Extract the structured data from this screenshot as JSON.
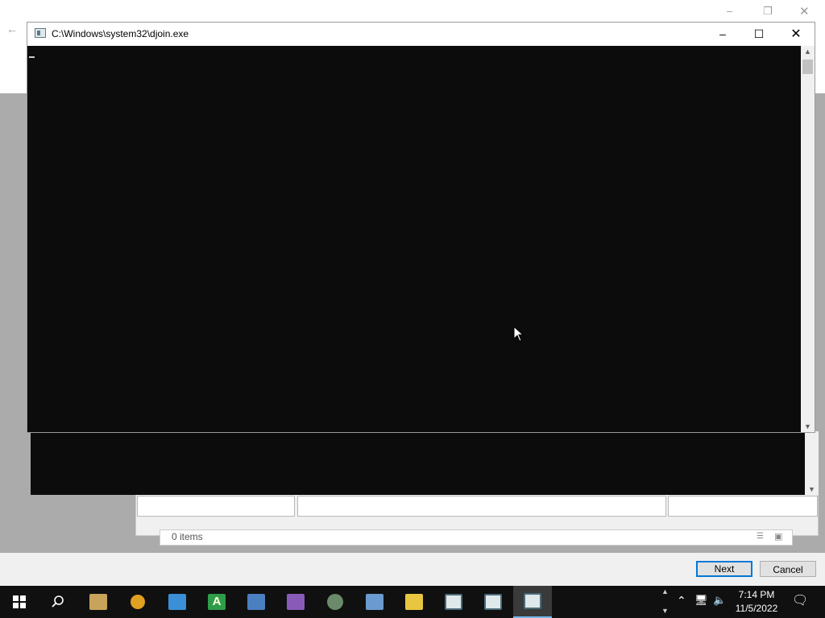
{
  "wizard": {
    "next_label": "Next",
    "cancel_label": "Cancel",
    "items_count": "0 items"
  },
  "console": {
    "title": "C:\\Windows\\system32\\djoin.exe"
  },
  "taskbar": {
    "time": "7:14 PM",
    "date": "11/5/2022",
    "apps": [
      "start-icon",
      "search-icon",
      "file-cabinet-icon",
      "magnifier-key-icon",
      "network-computer-icon",
      "font-a-icon",
      "document-tools-icon",
      "bookmark-icon",
      "disc-icon",
      "printer-computer-icon",
      "phone-icon",
      "window-app-icon",
      "window-app-icon",
      "window-app-icon"
    ]
  },
  "colors": {
    "console_bg": "#0c0c0c",
    "accent": "#0078d7",
    "taskbar_bg": "#101010"
  }
}
